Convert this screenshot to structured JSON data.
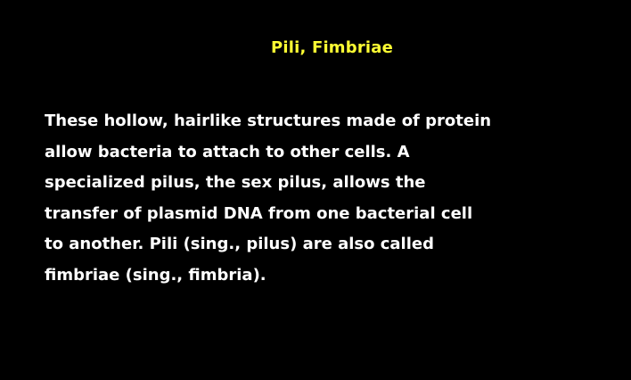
{
  "slide": {
    "title": "Pili, Fimbriae",
    "body_lines": [
      "These hollow, hairlike structures made of protein",
      "allow bacteria to attach to other cells. A",
      "specialized pilus, the sex pilus, allows the",
      "transfer of plasmid DNA from one bacterial cell",
      "to another. Pili (sing., pilus) are also called",
      "fimbriae (sing., fimbria)."
    ]
  },
  "colors": {
    "background": "#000000",
    "title": "#ffff33",
    "body": "#ffffff"
  }
}
